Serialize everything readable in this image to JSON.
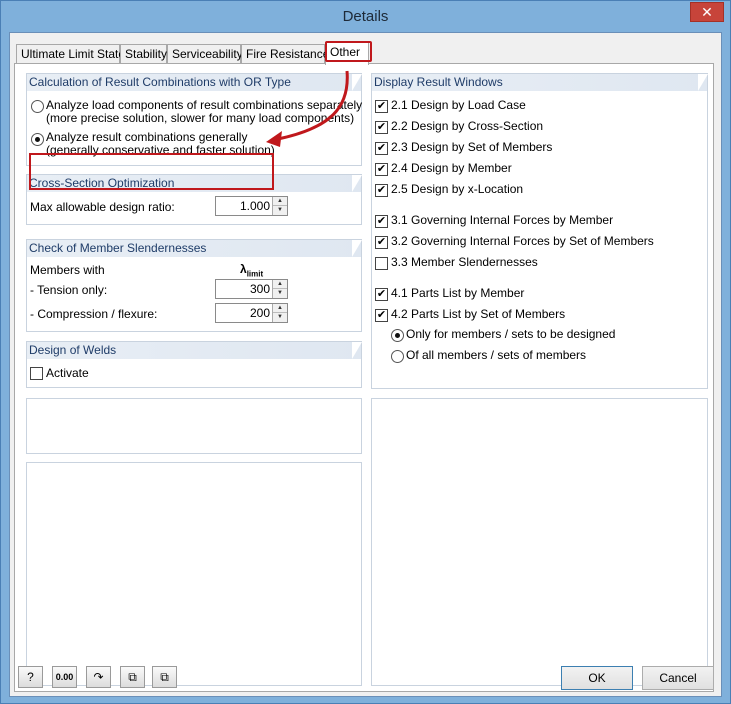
{
  "window": {
    "title": "Details",
    "close_glyph": "✕"
  },
  "tabs": [
    {
      "label": "Ultimate Limit State"
    },
    {
      "label": "Stability"
    },
    {
      "label": "Serviceability"
    },
    {
      "label": "Fire Resistance"
    },
    {
      "label": "Other",
      "active": true
    }
  ],
  "calc": {
    "title": "Calculation of Result Combinations with OR Type",
    "option1_line1": "Analyze load components of result combinations separately",
    "option1_line2": "(more precise solution, slower for many load components)",
    "option2_line1": "Analyze result combinations generally",
    "option2_line2": "(generally conservative and faster solution)",
    "selected": 2
  },
  "cso": {
    "title": "Cross-Section Optimization",
    "ratio_label": "Max allowable design ratio:",
    "ratio_value": "1.000"
  },
  "slender": {
    "title": "Check of Member Slendernesses",
    "members_with": "Members with",
    "lambda": "λ",
    "lambda_sub": "limit",
    "tension_label": "- Tension only:",
    "tension_value": "300",
    "compression_label": "- Compression / flexure:",
    "compression_value": "200"
  },
  "welds": {
    "title": "Design of Welds",
    "activate_label": "Activate",
    "activate_checked": false
  },
  "display": {
    "title": "Display Result Windows",
    "items": [
      {
        "label": "2.1 Design by Load Case",
        "checked": true
      },
      {
        "label": "2.2 Design by Cross-Section",
        "checked": true
      },
      {
        "label": "2.3 Design by Set of Members",
        "checked": true
      },
      {
        "label": "2.4 Design by Member",
        "checked": true
      },
      {
        "label": "2.5 Design by x-Location",
        "checked": true
      },
      {
        "label": "3.1 Governing Internal Forces by Member",
        "checked": true
      },
      {
        "label": "3.2 Governing Internal Forces by Set of Members",
        "checked": true
      },
      {
        "label": "3.3 Member Slendernesses",
        "checked": false
      },
      {
        "label": "4.1 Parts List by Member",
        "checked": true
      },
      {
        "label": "4.2 Parts List by Set of Members",
        "checked": true
      }
    ],
    "radio1": "Only for members / sets to be designed",
    "radio2": "Of all members / sets of members"
  },
  "bottom": {
    "ok": "OK",
    "cancel": "Cancel",
    "icons": [
      "help-icon",
      "decimal-places-icon",
      "default-settings-icon",
      "import-settings-icon",
      "export-settings-icon"
    ],
    "decimal_text": "0.00"
  },
  "colors": {
    "highlight_red": "#c0181c",
    "group_header": "#1f3c68"
  }
}
